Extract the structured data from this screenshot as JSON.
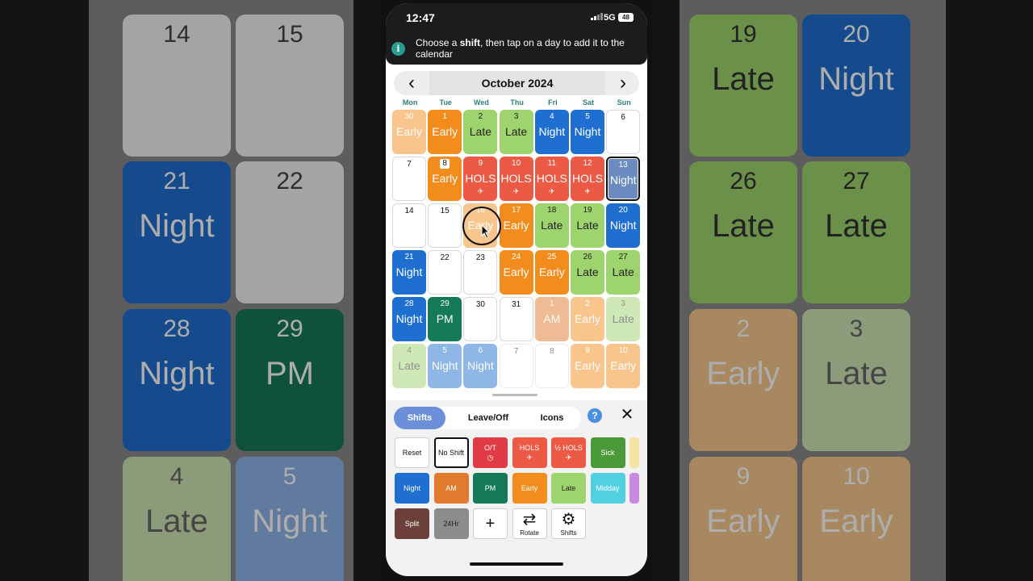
{
  "background": {
    "left_cells": [
      {
        "num": "14",
        "label": "",
        "color": "#f2f2f2",
        "num_color": "#444"
      },
      {
        "num": "15",
        "label": "",
        "color": "#f2f2f2",
        "num_color": "#444"
      },
      {
        "num": "21",
        "label": "Night",
        "color": "#1f6fd0",
        "num_color": "#fff"
      },
      {
        "num": "22",
        "label": "",
        "color": "#f2f2f2",
        "num_color": "#444"
      },
      {
        "num": "28",
        "label": "Night",
        "color": "#1f6fd0",
        "num_color": "#fff"
      },
      {
        "num": "29",
        "label": "PM",
        "color": "#157a5a",
        "num_color": "#fff"
      },
      {
        "num": "4",
        "label": "Late",
        "color": "#cfe6b4",
        "num_color": "#666"
      },
      {
        "num": "5",
        "label": "Night",
        "color": "#8fb5ea",
        "num_color": "#fff"
      }
    ],
    "right_cells": [
      {
        "num": "19",
        "label": "Late",
        "color": "#9ed46e",
        "num_color": "#333"
      },
      {
        "num": "20",
        "label": "Night",
        "color": "#1f6fd0",
        "num_color": "#fff"
      },
      {
        "num": "26",
        "label": "Late",
        "color": "#9ed46e",
        "num_color": "#333"
      },
      {
        "num": "27",
        "label": "Late",
        "color": "#9ed46e",
        "num_color": "#333"
      },
      {
        "num": "2",
        "label": "Early",
        "color": "#f7c98e",
        "num_color": "#fff"
      },
      {
        "num": "3",
        "label": "Late",
        "color": "#cfe6b4",
        "num_color": "#666"
      },
      {
        "num": "9",
        "label": "Early",
        "color": "#f7c98e",
        "num_color": "#fff"
      },
      {
        "num": "10",
        "label": "Early",
        "color": "#f7c98e",
        "num_color": "#fff"
      }
    ]
  },
  "status_bar": {
    "time": "12:47",
    "network": "5G",
    "battery": "48"
  },
  "banner": {
    "text_before": "Choose a ",
    "text_bold": "shift",
    "text_after": ", then tap on a day to add it to the calendar"
  },
  "calendar": {
    "month_title": "October 2024",
    "prev": "‹",
    "next": "›",
    "weekdays": [
      "Mon",
      "Tue",
      "Wed",
      "Thu",
      "Fri",
      "Sat",
      "Sun"
    ],
    "weeks": [
      [
        {
          "day": "30",
          "shift": "Early",
          "color": "#f28c1c",
          "faded": true
        },
        {
          "day": "1",
          "shift": "Early",
          "color": "#f28c1c"
        },
        {
          "day": "2",
          "shift": "Late",
          "color": "#9ed46e",
          "dark": true
        },
        {
          "day": "3",
          "shift": "Late",
          "color": "#9ed46e",
          "dark": true
        },
        {
          "day": "4",
          "shift": "Night",
          "color": "#1f6fd0"
        },
        {
          "day": "5",
          "shift": "Night",
          "color": "#1f6fd0"
        },
        {
          "day": "6",
          "shift": ""
        }
      ],
      [
        {
          "day": "7",
          "shift": ""
        },
        {
          "day": "8",
          "shift": "Early",
          "color": "#f28c1c",
          "boxed": true
        },
        {
          "day": "9",
          "shift": "HOLS",
          "color": "#ec5a45",
          "icon": "✈"
        },
        {
          "day": "10",
          "shift": "HOLS",
          "color": "#ec5a45",
          "icon": "✈"
        },
        {
          "day": "11",
          "shift": "HOLS",
          "color": "#ec5a45",
          "icon": "✈"
        },
        {
          "day": "12",
          "shift": "HOLS",
          "color": "#ec5a45",
          "icon": "✈"
        },
        {
          "day": "13",
          "shift": "Night",
          "color": "#6a8cc0",
          "selected": true
        }
      ],
      [
        {
          "day": "14",
          "shift": ""
        },
        {
          "day": "15",
          "shift": ""
        },
        {
          "day": "16",
          "shift": "Early",
          "color": "#f28c1c",
          "faded": true
        },
        {
          "day": "17",
          "shift": "Early",
          "color": "#f28c1c"
        },
        {
          "day": "18",
          "shift": "Late",
          "color": "#9ed46e",
          "dark": true
        },
        {
          "day": "19",
          "shift": "Late",
          "color": "#9ed46e",
          "dark": true
        },
        {
          "day": "20",
          "shift": "Night",
          "color": "#1f6fd0"
        }
      ],
      [
        {
          "day": "21",
          "shift": "Night",
          "color": "#1f6fd0"
        },
        {
          "day": "22",
          "shift": ""
        },
        {
          "day": "23",
          "shift": ""
        },
        {
          "day": "24",
          "shift": "Early",
          "color": "#f28c1c"
        },
        {
          "day": "25",
          "shift": "Early",
          "color": "#f28c1c"
        },
        {
          "day": "26",
          "shift": "Late",
          "color": "#9ed46e",
          "dark": true
        },
        {
          "day": "27",
          "shift": "Late",
          "color": "#9ed46e",
          "dark": true
        }
      ],
      [
        {
          "day": "28",
          "shift": "Night",
          "color": "#1f6fd0"
        },
        {
          "day": "29",
          "shift": "PM",
          "color": "#157a5a"
        },
        {
          "day": "30",
          "shift": ""
        },
        {
          "day": "31",
          "shift": ""
        },
        {
          "day": "1",
          "shift": "AM",
          "color": "#e07a2c",
          "faded": true
        },
        {
          "day": "2",
          "shift": "Early",
          "color": "#f28c1c",
          "faded": true
        },
        {
          "day": "3",
          "shift": "Late",
          "color": "#9ed46e",
          "dark": true,
          "faded": true
        }
      ],
      [
        {
          "day": "4",
          "shift": "Late",
          "color": "#9ed46e",
          "dark": true,
          "faded": true
        },
        {
          "day": "5",
          "shift": "Night",
          "color": "#1f6fd0",
          "faded": true
        },
        {
          "day": "6",
          "shift": "Night",
          "color": "#1f6fd0",
          "faded": true
        },
        {
          "day": "7",
          "shift": "",
          "faded": true
        },
        {
          "day": "8",
          "shift": "",
          "faded": true
        },
        {
          "day": "9",
          "shift": "Early",
          "color": "#f28c1c",
          "faded": true
        },
        {
          "day": "10",
          "shift": "Early",
          "color": "#f28c1c",
          "faded": true
        }
      ]
    ]
  },
  "panel": {
    "tabs": [
      {
        "label": "Shifts",
        "active": true
      },
      {
        "label": "Leave/Off",
        "active": false
      },
      {
        "label": "Icons",
        "active": false
      }
    ],
    "help": "?",
    "close": "✕",
    "rows": [
      [
        {
          "label": "Reset",
          "style": "white"
        },
        {
          "label": "No Shift",
          "style": "white-bold"
        },
        {
          "label": "O/T",
          "color": "#e03a44",
          "icon": "clock-icon",
          "glyph": "◷"
        },
        {
          "label": "HOLS",
          "color": "#ec5a45",
          "icon": "plane-icon",
          "glyph": "✈"
        },
        {
          "label": "½ HOLS",
          "color": "#ec5a45",
          "icon": "plane-icon",
          "glyph": "✈"
        },
        {
          "label": "Sick",
          "color": "#4a9a3a"
        },
        {
          "label": "",
          "color": "#f5e3a0"
        }
      ],
      [
        {
          "label": "Night",
          "color": "#1f6fd0"
        },
        {
          "label": "AM",
          "color": "#e07a2c"
        },
        {
          "label": "PM",
          "color": "#157a5a"
        },
        {
          "label": "Early",
          "color": "#f28c1c"
        },
        {
          "label": "Late",
          "color": "#9ed46e",
          "dark": true
        },
        {
          "label": "Midday",
          "color": "#52d0e0"
        },
        {
          "label": "",
          "color": "#c98be0"
        }
      ],
      [
        {
          "label": "Split",
          "color": "#6b3f3a"
        },
        {
          "label": "24Hr",
          "color": "#8c8c8c",
          "dark": true
        },
        {
          "label": "",
          "style": "white",
          "big": "+",
          "icon": "plus-icon"
        },
        {
          "label": "Rotate",
          "style": "white",
          "big": "⇄",
          "icon": "rotate-icon"
        },
        {
          "label": "Shifts",
          "style": "white",
          "big": "⚙",
          "icon": "gear-icon"
        }
      ]
    ]
  }
}
